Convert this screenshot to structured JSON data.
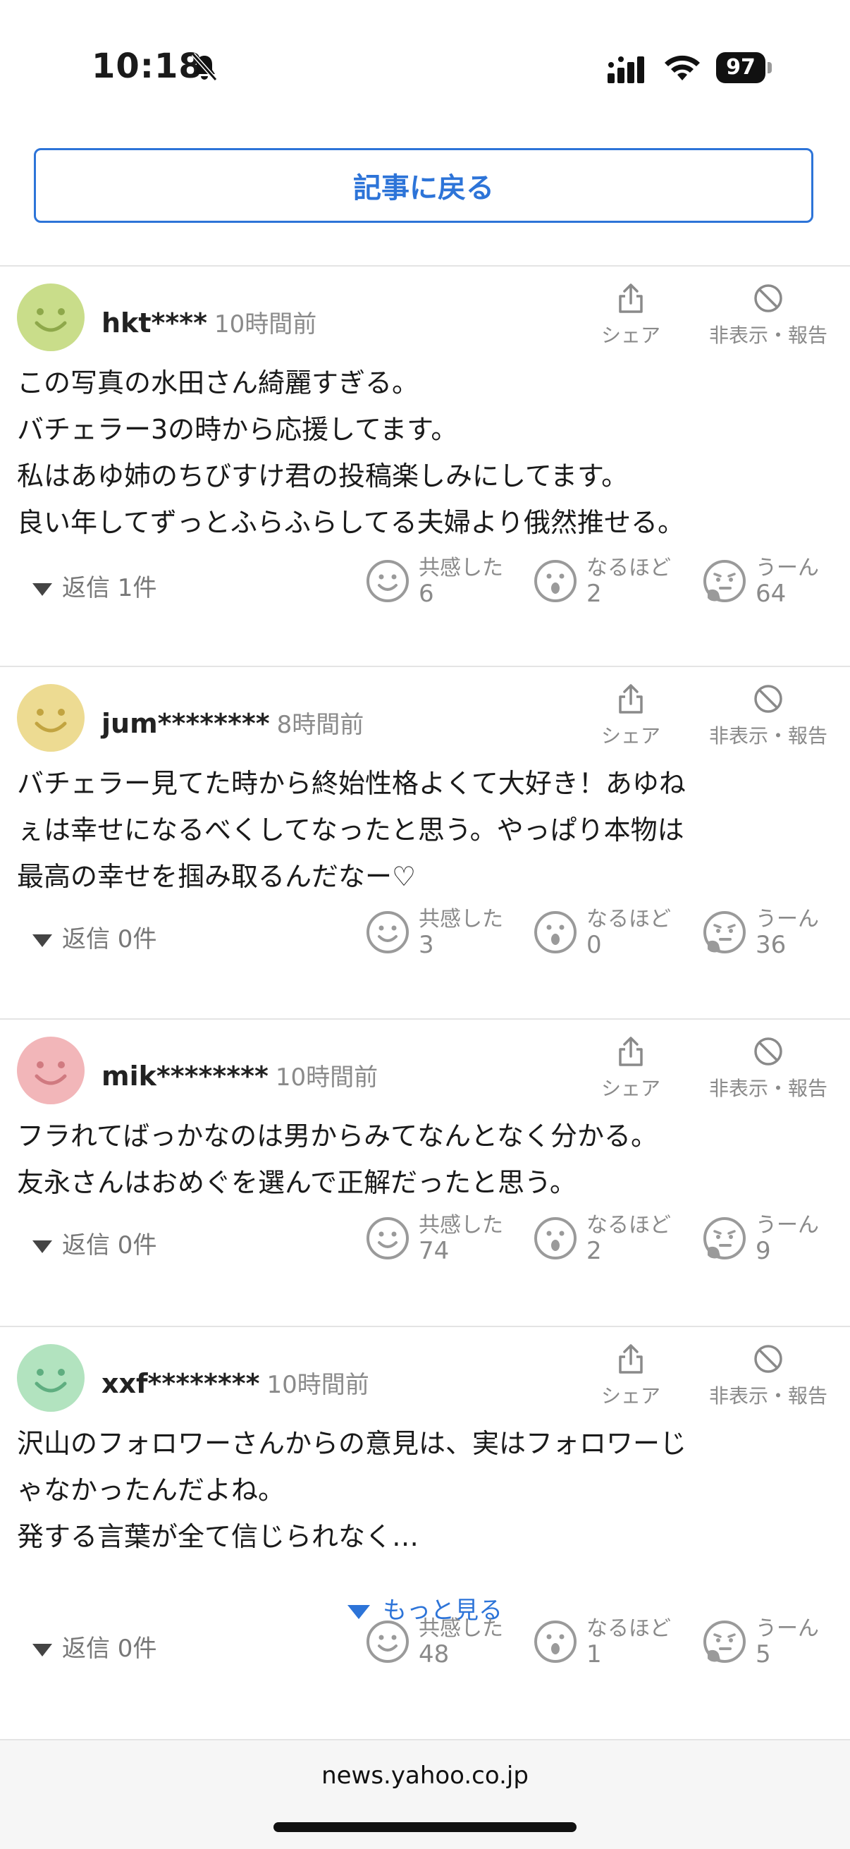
{
  "status": {
    "time": "10:18",
    "battery": "97"
  },
  "back_button": "記事に戻る",
  "labels": {
    "share": "シェア",
    "hide": "非表示・報告",
    "empathy": "共感した",
    "naruhodo": "なるほど",
    "uun": "うーん",
    "more": "もっと見る"
  },
  "colors": {
    "accent": "#2d74d8"
  },
  "comments": [
    {
      "user": "hkt****",
      "ago": "10時間前",
      "avatar_color": "#c9dd8a",
      "lines": [
        "この写真の水田さん綺麗すぎる。",
        "バチェラー3の時から応援してます。",
        "私はあゆ姉のちびすけ君の投稿楽しみにしてます。",
        "良い年してずっとふらふらしてる夫婦より俄然推せる。"
      ],
      "reply": "返信 1件",
      "empathy": "6",
      "naruhodo": "2",
      "uun": "64"
    },
    {
      "user": "jum********",
      "ago": "8時間前",
      "avatar_color": "#eddb92",
      "lines": [
        "バチェラー見てた時から終始性格よくて大好き！あゆね",
        "ぇは幸せになるべくしてなったと思う。やっぱり本物は",
        "最高の幸せを掴み取るんだなー♡"
      ],
      "reply": "返信 0件",
      "empathy": "3",
      "naruhodo": "0",
      "uun": "36"
    },
    {
      "user": "mik********",
      "ago": "10時間前",
      "avatar_color": "#f2b6b9",
      "lines": [
        "フラれてばっかなのは男からみてなんとなく分かる。",
        "友永さんはおめぐを選んで正解だったと思う。"
      ],
      "reply": "返信 0件",
      "empathy": "74",
      "naruhodo": "2",
      "uun": "9"
    },
    {
      "user": "xxf********",
      "ago": "10時間前",
      "avatar_color": "#b2e3bf",
      "lines": [
        "沢山のフォロワーさんからの意見は、実はフォロワーじ",
        "ゃなかったんだよね。",
        "発する言葉が全て信じられなく…"
      ],
      "reply": "返信 0件",
      "empathy": "48",
      "naruhodo": "1",
      "uun": "5"
    }
  ],
  "url": "news.yahoo.co.jp"
}
